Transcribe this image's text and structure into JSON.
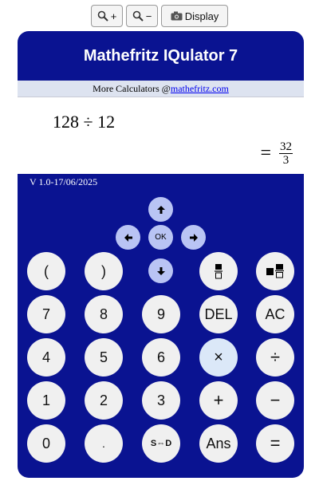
{
  "toolbar": {
    "zoom_in_label": "+",
    "zoom_out_label": "−",
    "display_label": "Display",
    "display_icon": "camera"
  },
  "calculator": {
    "title": "Mathefritz IQulator 7",
    "more_prefix": "More Calculators @",
    "more_link": "mathefritz.com",
    "expression": "128 ÷ 12",
    "result_equals": "=",
    "result_numerator": "32",
    "result_denominator": "3",
    "version": "V 1.0-17/06/2025"
  },
  "nav": {
    "ok_label": "OK"
  },
  "keys": {
    "open_paren": "(",
    "close_paren": ")",
    "seven": "7",
    "eight": "8",
    "nine": "9",
    "four": "4",
    "five": "5",
    "six": "6",
    "one": "1",
    "two": "2",
    "three": "3",
    "zero": "0",
    "dot": ".",
    "del": "DEL",
    "ac": "AC",
    "multiply": "×",
    "divide": "÷",
    "plus": "+",
    "minus": "−",
    "s_to_d": "S⇔D",
    "ans": "Ans",
    "equals": "="
  }
}
